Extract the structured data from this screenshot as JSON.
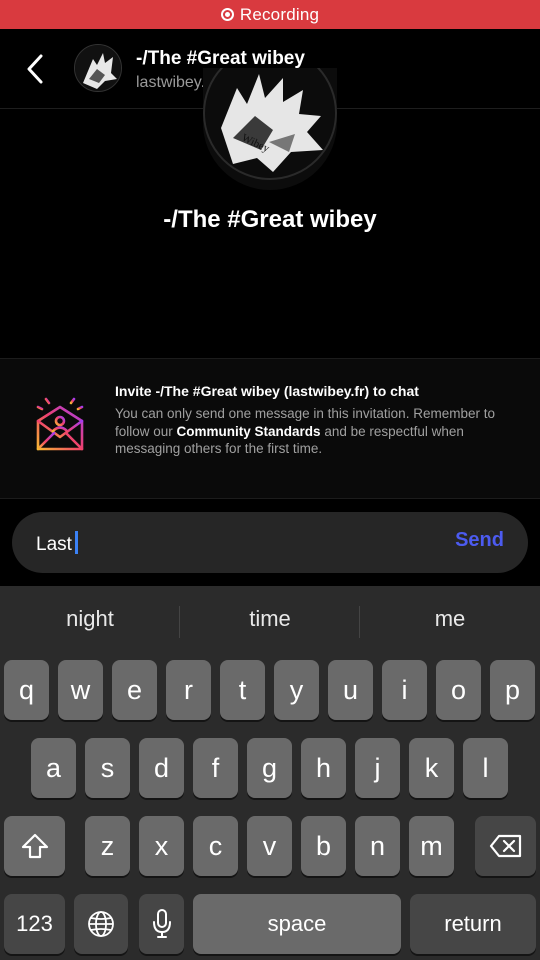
{
  "recording": {
    "label": "Recording"
  },
  "header": {
    "name": "-/The #Great wibey",
    "subtitle": "lastwibey.fr",
    "avatar_text": "Wibey"
  },
  "profile": {
    "name": "-/The #Great wibey"
  },
  "invite": {
    "title": "Invite -/The #Great wibey (lastwibey.fr) to chat",
    "body_before": "You can only send one message in this invitation. Remember to follow our ",
    "body_link": "Community Standards",
    "body_after": " and be respectful when messaging others for the first time."
  },
  "composer": {
    "value": "Last",
    "send_label": "Send"
  },
  "keyboard": {
    "suggestions": [
      "night",
      "time",
      "me"
    ],
    "row1": [
      "q",
      "w",
      "e",
      "r",
      "t",
      "y",
      "u",
      "i",
      "o",
      "p"
    ],
    "row2": [
      "a",
      "s",
      "d",
      "f",
      "g",
      "h",
      "j",
      "k",
      "l"
    ],
    "row3": [
      "z",
      "x",
      "c",
      "v",
      "b",
      "n",
      "m"
    ],
    "numbers_label": "123",
    "space_label": "space",
    "return_label": "return"
  },
  "colors": {
    "recording": "#d93a3f",
    "send": "#4c5bf0",
    "caret": "#3b82f6"
  },
  "icons": [
    "record-icon",
    "back-chevron-icon",
    "invite-envelope-icon",
    "shift-icon",
    "backspace-icon",
    "globe-icon",
    "microphone-icon"
  ]
}
